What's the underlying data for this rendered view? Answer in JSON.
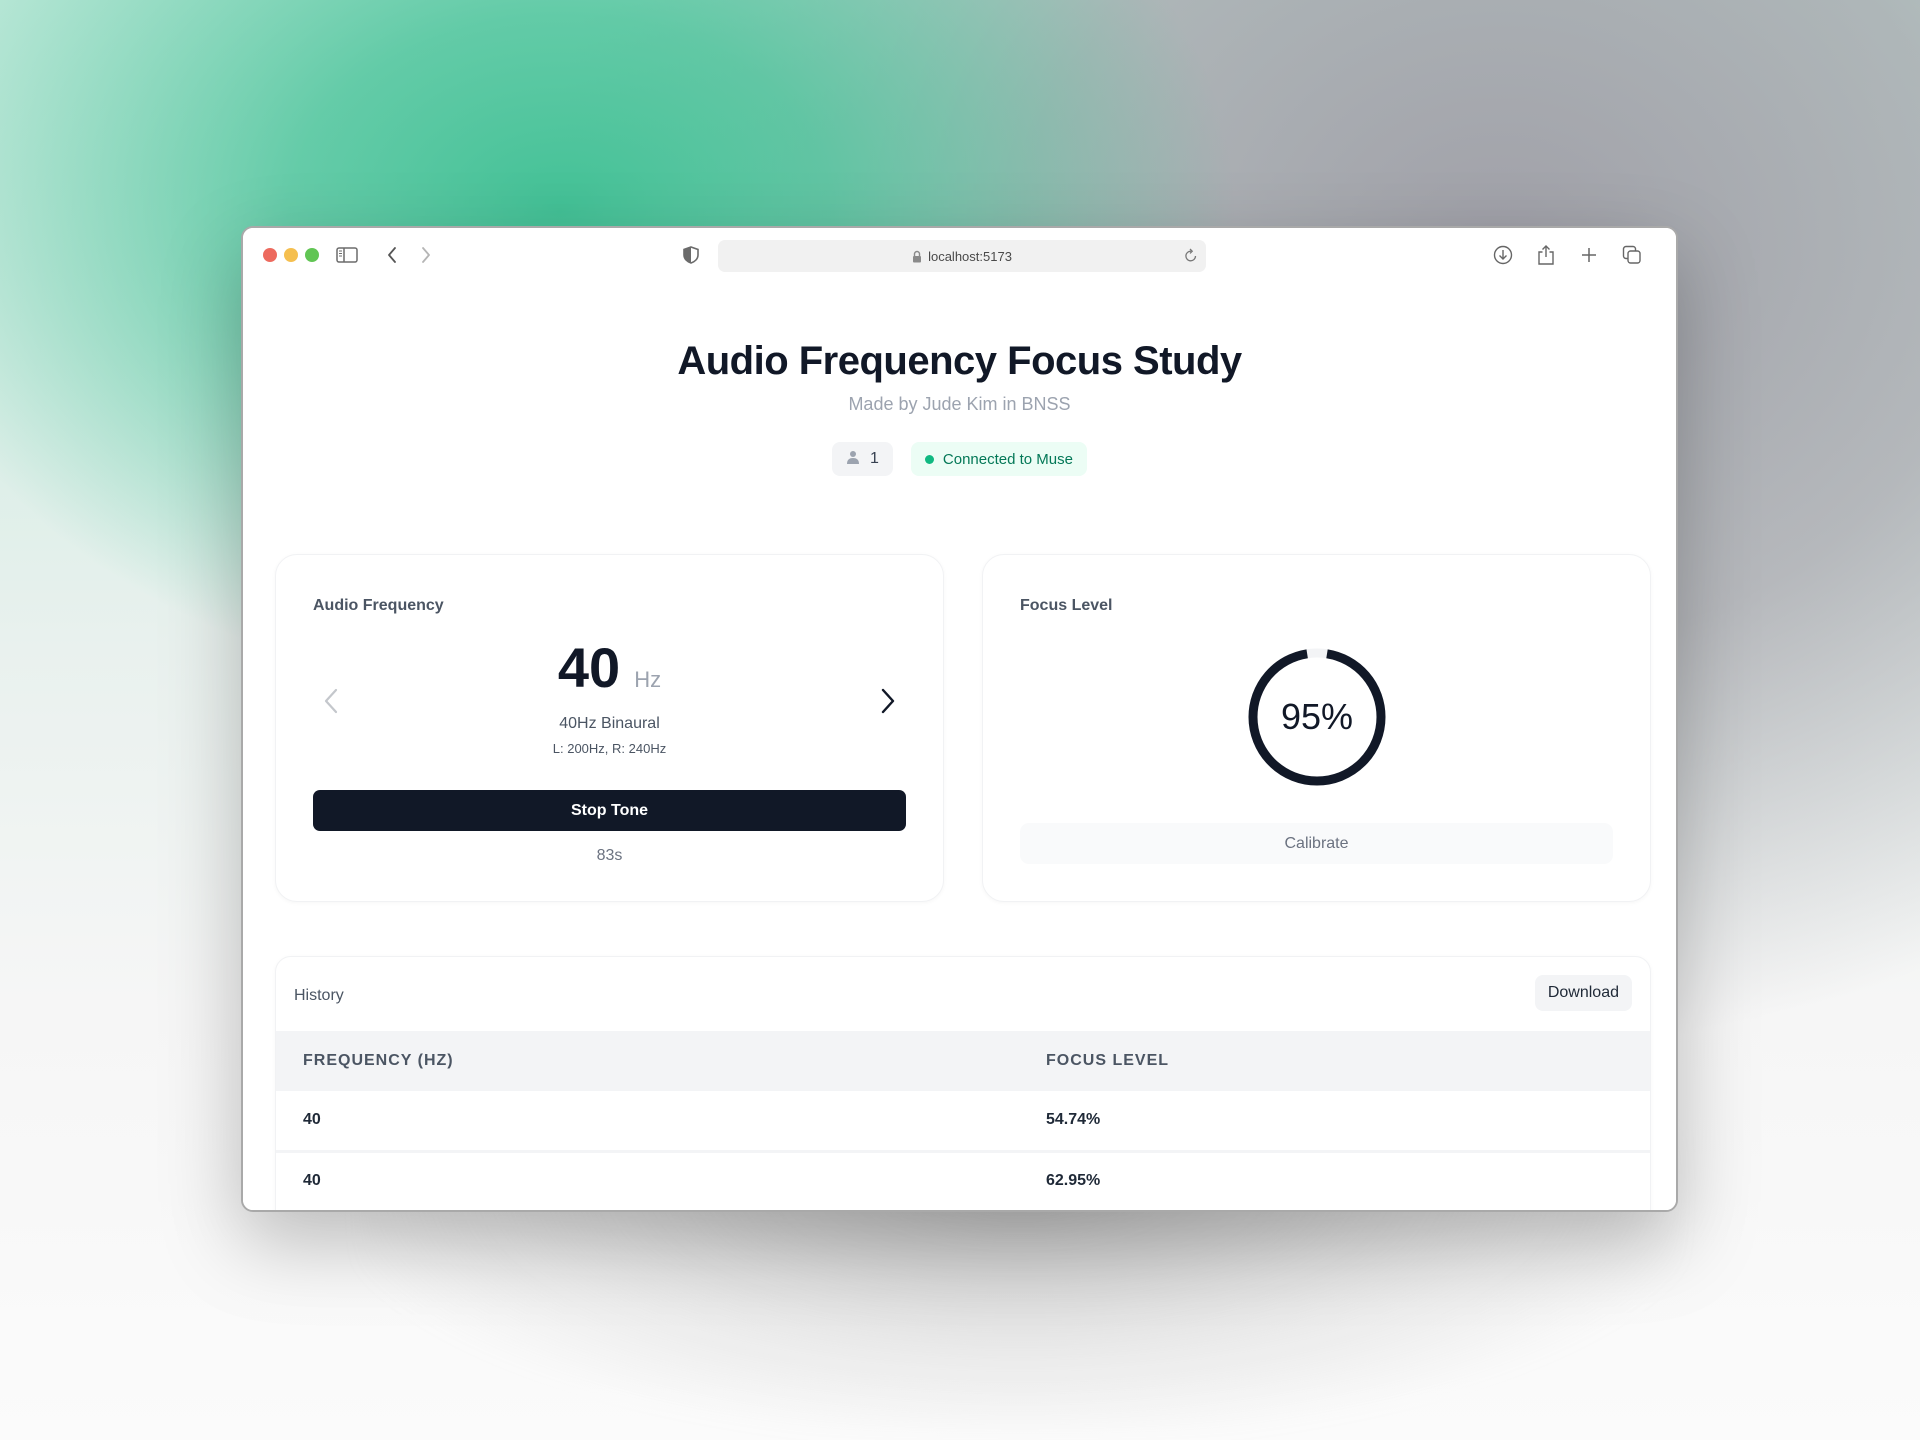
{
  "browser": {
    "url": "localhost:5173",
    "icons": {
      "sidebar": "sidebar-icon",
      "back": "chevron-left-icon",
      "forward": "chevron-right-icon",
      "shield": "shield-icon",
      "lock": "lock-icon",
      "reload": "reload-icon",
      "download": "download-icon",
      "share": "share-icon",
      "new_tab": "plus-icon",
      "tabs": "tabs-overview-icon"
    }
  },
  "header": {
    "title": "Audio Frequency Focus Study",
    "subtitle": "Made by Jude Kim in BNSS",
    "user_count": "1",
    "connection_status": "Connected to Muse",
    "status_color": "#10b981"
  },
  "audio_card": {
    "label": "Audio Frequency",
    "frequency_value": "40",
    "frequency_unit": "Hz",
    "preset_name": "40Hz Binaural",
    "channels": "L: 200Hz, R: 240Hz",
    "stop_button": "Stop Tone",
    "elapsed": "83s"
  },
  "focus_card": {
    "label": "Focus Level",
    "percent": 95,
    "percent_text": "95%",
    "calibrate_button": "Calibrate",
    "ring_color": "#111827",
    "track_color": "#f3f4f6"
  },
  "history": {
    "label": "History",
    "download_button": "Download",
    "columns": [
      "FREQUENCY (HZ)",
      "FOCUS LEVEL"
    ],
    "rows": [
      {
        "frequency": "40",
        "focus": "54.74%"
      },
      {
        "frequency": "40",
        "focus": "62.95%"
      }
    ]
  }
}
